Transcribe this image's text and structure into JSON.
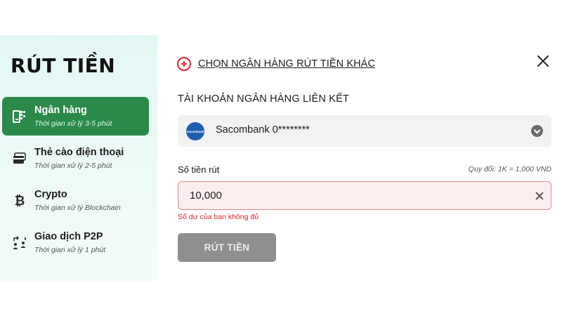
{
  "sidebar": {
    "title": "RÚT TIỀN",
    "items": [
      {
        "label": "Ngân hàng",
        "sub": "Thời gian xử lý 3-5 phút",
        "icon": "bank-qr-icon",
        "active": true
      },
      {
        "label": "Thẻ cào điện thoại",
        "sub": "Thời gian xử lý 2-5 phút",
        "icon": "phone-card-icon",
        "active": false
      },
      {
        "label": "Crypto",
        "sub": "Thời gian xử lý Blockchain",
        "icon": "bitcoin-icon",
        "active": false
      },
      {
        "label": "Giao dịch P2P",
        "sub": "Thời gian xử lý 1 phút",
        "icon": "p2p-exchange-icon",
        "active": false
      }
    ]
  },
  "content": {
    "other_bank_label": "CHỌN NGÂN HÀNG RÚT TIỀN KHÁC",
    "linked_account_title": "TÀI KHOẢN NGÂN HÀNG LIÊN KẾT",
    "bank_account": "Sacombank 0********",
    "bank_logo_text": "Sacombank",
    "amount_label": "Số tiền rút",
    "rate_note": "Quy đổi: 1K = 1,000 VND",
    "amount_value": "10,000",
    "error_text": "Số dư của bạn không đủ",
    "submit_label": "RÚT TIỀN"
  },
  "colors": {
    "active_green": "#2b8a4a",
    "error_red": "#d9272e",
    "disabled_button": "#8e8f91"
  }
}
